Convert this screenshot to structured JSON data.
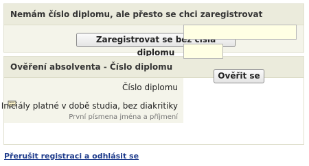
{
  "no_diploma_section": {
    "title": "Nemám číslo diplomu, ale přesto se chci zaregistrovat",
    "register_button_label": "Zaregistrovat se bez čísla diplomu"
  },
  "verification_section": {
    "title": "Ověření absolventa - Číslo diplomu",
    "diploma_number_label": "Číslo diplomu",
    "diploma_number_value": "",
    "initials_label": "Iniciály platné v době studia, bez diakritiky",
    "initials_hint": "První písmena jména a příjmení",
    "initials_value": "",
    "verify_button_label": "Ověřit se"
  },
  "logout_link_label": "Přerušit registraci a odhlásit se",
  "icons": {
    "comment": "comment-icon"
  },
  "colors": {
    "header_bg": "#ebebdc",
    "input_bg": "#ffffe4",
    "link": "#1f3c8c"
  }
}
